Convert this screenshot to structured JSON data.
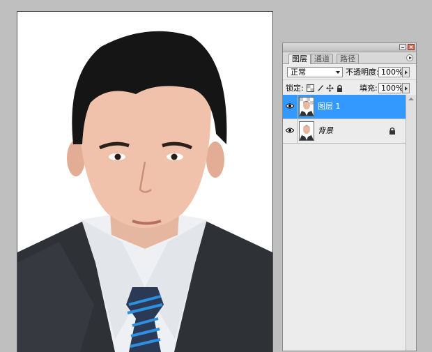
{
  "panel": {
    "tabs": [
      "图层",
      "通道",
      "路径"
    ],
    "blend_mode": "正常",
    "opacity_label": "不透明度:",
    "opacity_value": "100%",
    "lock_label": "锁定:",
    "fill_label": "填充:",
    "fill_value": "100%",
    "layers": [
      {
        "name": "图层 1",
        "selected": true,
        "visible": true,
        "locked": false
      },
      {
        "name": "背景",
        "selected": false,
        "visible": true,
        "locked": true
      }
    ]
  },
  "colors": {
    "selected_layer": "#3399ff",
    "workspace": "#bfbfbf",
    "panel_bg": "#ececec"
  }
}
